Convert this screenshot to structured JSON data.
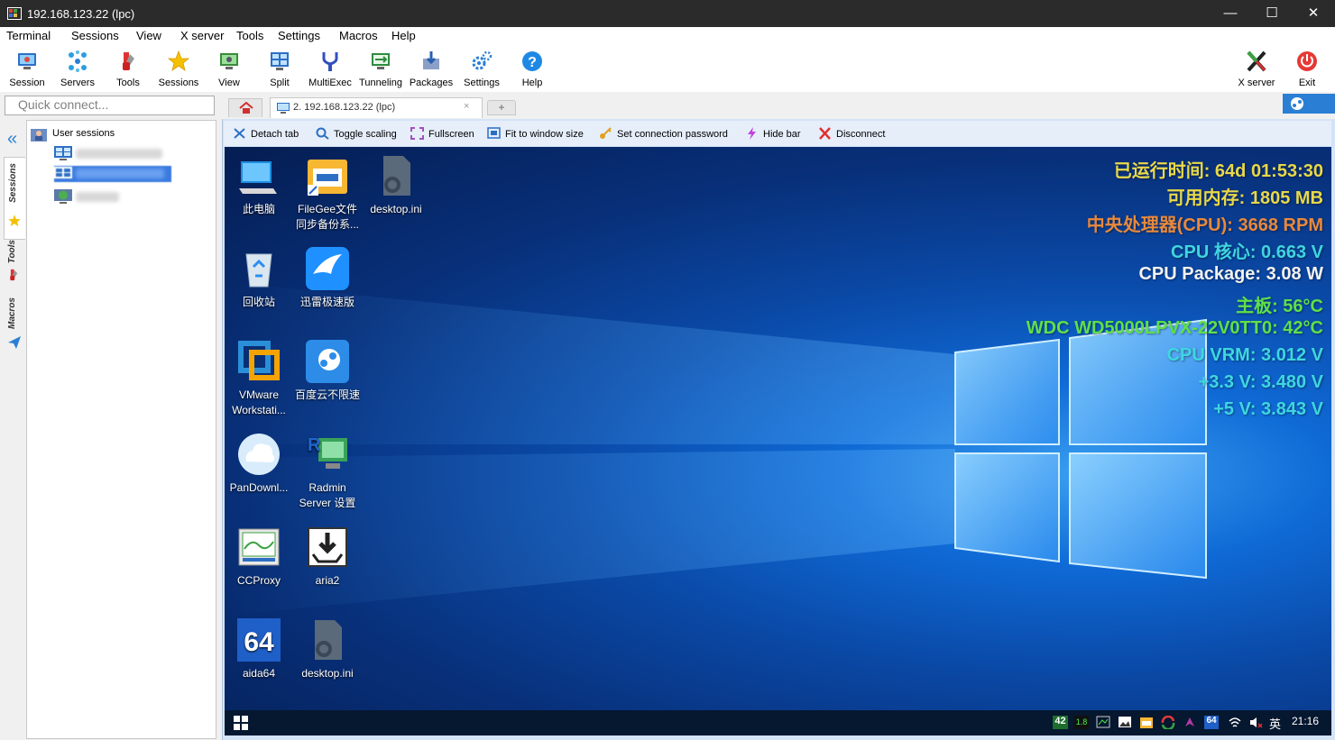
{
  "window": {
    "title": "192.168.123.22 (lpc)",
    "minimize": "—",
    "maximize": "☐",
    "close": "✕"
  },
  "menu": [
    "Terminal",
    "Sessions",
    "View",
    "X server",
    "Tools",
    "Settings",
    "Macros",
    "Help"
  ],
  "toolbar": {
    "items": [
      "Session",
      "Servers",
      "Tools",
      "Sessions",
      "View",
      "Split",
      "MultiExec",
      "Tunneling",
      "Packages",
      "Settings",
      "Help"
    ],
    "xserver": "X server",
    "exit": "Exit"
  },
  "quick_connect": {
    "placeholder": "Quick connect..."
  },
  "tabs": {
    "active_label": "2. 192.168.123.22 (lpc)",
    "close": "×",
    "new": "+"
  },
  "sidebar": {
    "vertical_tabs": [
      "Sessions",
      "Tools",
      "Macros"
    ],
    "root_label": "User sessions",
    "collapse": "«"
  },
  "remote_bar": [
    "Detach tab",
    "Toggle scaling",
    "Fullscreen",
    "Fit to window size",
    "Set connection password",
    "Hide bar",
    "Disconnect"
  ],
  "desktop_icons": [
    [
      "此电脑"
    ],
    [
      "FileGee文件",
      "同步备份系..."
    ],
    [
      "desktop.ini"
    ],
    [
      "回收站"
    ],
    [
      "迅雷极速版"
    ],
    [
      "VMware",
      "Workstati..."
    ],
    [
      "百度云不限速"
    ],
    [
      "PanDownl..."
    ],
    [
      "Radmin",
      "Server 设置"
    ],
    [
      "CCProxy"
    ],
    [
      "aria2"
    ],
    [
      "aida64"
    ],
    [
      "desktop.ini"
    ]
  ],
  "sensor_overlay": [
    {
      "text": "已运行时间: 64d 01:53:30",
      "color": "#e8d84a"
    },
    {
      "text": "可用内存: 1805 MB",
      "color": "#e8d84a"
    },
    {
      "text": "中央处理器(CPU): 3668 RPM",
      "color": "#e8893c"
    },
    {
      "text": "CPU 核心: 0.663 V",
      "color": "#3fd6e0"
    },
    {
      "text": "CPU Package: 3.08 W",
      "color": "#f2f2f2"
    },
    {
      "text": "主板: 56°C",
      "color": "#5fe04a"
    },
    {
      "text": "WDC WD5000LPVX-22V0TT0: 42°C",
      "color": "#5fe04a"
    },
    {
      "text": "CPU VRM: 3.012 V",
      "color": "#3fd6e0"
    },
    {
      "text": "+3.3 V: 3.480 V",
      "color": "#3fd6e0"
    },
    {
      "text": "+5 V: 3.843 V",
      "color": "#3fd6e0"
    }
  ],
  "taskbar": {
    "tray_42": "42",
    "tray_18": "1.8",
    "tray_64": "64",
    "ime": "英",
    "clock": "21:16"
  }
}
